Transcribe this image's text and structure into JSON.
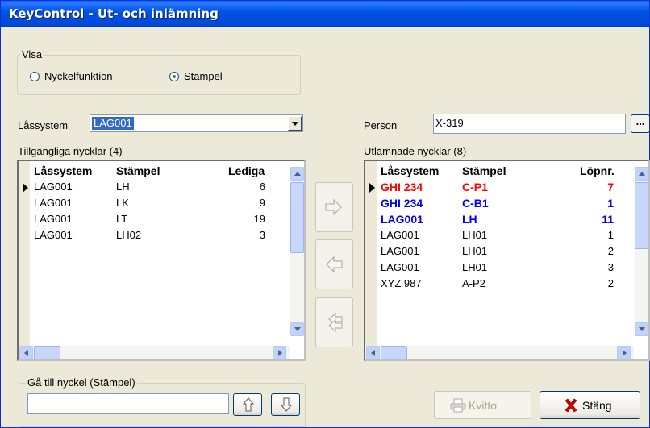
{
  "window": {
    "title": "KeyControl - Ut- och inlämning"
  },
  "visa": {
    "legend": "Visa",
    "options": [
      {
        "label": "Nyckelfunktion",
        "selected": false
      },
      {
        "label": "Stämpel",
        "selected": true
      }
    ]
  },
  "lassystem": {
    "label": "Låssystem",
    "value": "LAG001"
  },
  "person": {
    "label": "Person",
    "value": "X-319",
    "browse_label": "..."
  },
  "available": {
    "title": "Tillgängliga nycklar (4)",
    "columns": [
      "Låssystem",
      "Stämpel",
      "Lediga"
    ],
    "rows": [
      {
        "lassystem": "LAG001",
        "stampel": "LH",
        "lediga": "6"
      },
      {
        "lassystem": "LAG001",
        "stampel": "LK",
        "lediga": "9"
      },
      {
        "lassystem": "LAG001",
        "stampel": "LT",
        "lediga": "19"
      },
      {
        "lassystem": "LAG001",
        "stampel": "LH02",
        "lediga": "3"
      }
    ]
  },
  "lent": {
    "title": "Utlämnade nycklar (8)",
    "columns": [
      "Låssystem",
      "Stämpel",
      "Löpnr."
    ],
    "rows": [
      {
        "lassystem": "GHI 234",
        "stampel": "C-P1",
        "lopnr": "7",
        "color": "#ff0000",
        "bold": true
      },
      {
        "lassystem": "GHI 234",
        "stampel": "C-B1",
        "lopnr": "1",
        "color": "#0000ff",
        "bold": true
      },
      {
        "lassystem": "LAG001",
        "stampel": "LH",
        "lopnr": "11",
        "color": "#0000ff",
        "bold": true
      },
      {
        "lassystem": "LAG001",
        "stampel": "LH01",
        "lopnr": "1",
        "color": "#000000",
        "bold": false
      },
      {
        "lassystem": "LAG001",
        "stampel": "LH01",
        "lopnr": "2",
        "color": "#000000",
        "bold": false
      },
      {
        "lassystem": "LAG001",
        "stampel": "LH01",
        "lopnr": "3",
        "color": "#000000",
        "bold": false
      },
      {
        "lassystem": "XYZ 987",
        "stampel": "A-P2",
        "lopnr": "2",
        "color": "#000000",
        "bold": false
      }
    ]
  },
  "goto": {
    "legend": "Gå till nyckel (Stämpel)",
    "value": ""
  },
  "buttons": {
    "kvitto": "Kvitto",
    "stang": "Stäng"
  },
  "colors": {
    "title_bar": "#0054e3",
    "selection": "#316ac5",
    "red": "#ff0000",
    "blue": "#0000ff"
  }
}
